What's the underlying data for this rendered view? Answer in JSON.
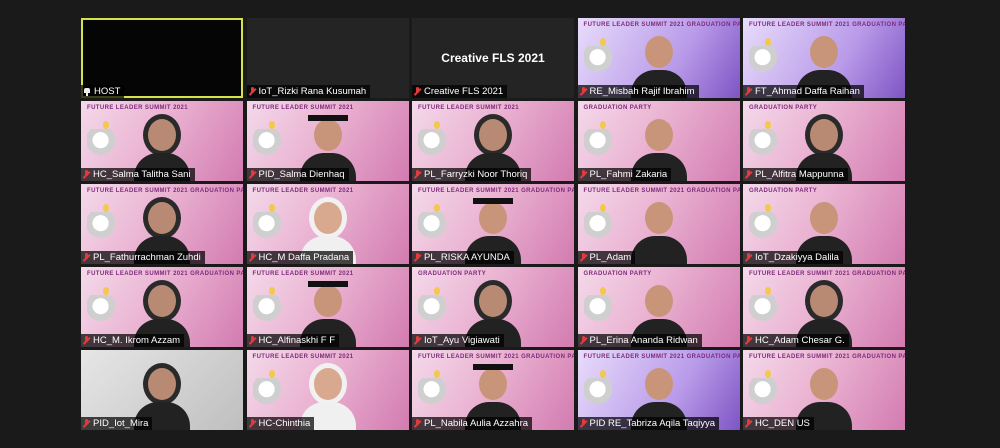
{
  "meeting": {
    "title_tile_text": "Creative FLS 2021",
    "tiles": [
      {
        "name": "HOST",
        "muted": false,
        "pinned": true,
        "bg": "host"
      },
      {
        "name": "IoT_Rizki Rana Kusumah",
        "muted": true,
        "bg": "dark"
      },
      {
        "name": "Creative FLS 2021",
        "muted": true,
        "bg": "dark",
        "center_title": "Creative FLS 2021"
      },
      {
        "name": "RE_Misbah Rajif Ibrahim",
        "muted": true,
        "bg": "purple",
        "banner": "FUTURE LEADER SUMMIT 2021 GRADUATION PARTY"
      },
      {
        "name": "FT_Ahmad Daffa Raihan",
        "muted": true,
        "bg": "purple",
        "banner": "FUTURE LEADER SUMMIT 2021 GRADUATION PARTY"
      },
      {
        "name": "HC_Salma Talitha Sani",
        "muted": true,
        "bg": "pink",
        "banner": "FUTURE LEADER SUMMIT 2021"
      },
      {
        "name": "PID_Salma Dienhaq",
        "muted": true,
        "bg": "pink",
        "banner": "FUTURE LEADER SUMMIT 2021"
      },
      {
        "name": "PL_Farryzki Noor Thoriq",
        "muted": true,
        "bg": "pink",
        "banner": "FUTURE LEADER SUMMIT 2021"
      },
      {
        "name": "PL_Fahmi Zakaria",
        "muted": true,
        "bg": "pink",
        "banner": "GRADUATION PARTY"
      },
      {
        "name": "PL_Alfitra Mappunna",
        "muted": true,
        "bg": "pink",
        "banner": "GRADUATION PARTY"
      },
      {
        "name": "PL_Fathurrachman Zuhdi",
        "muted": true,
        "bg": "pink",
        "banner": "FUTURE LEADER SUMMIT 2021 GRADUATION PARTY"
      },
      {
        "name": "HC_M Daffa Pradana",
        "muted": true,
        "bg": "pink",
        "banner": "FUTURE LEADER SUMMIT 2021"
      },
      {
        "name": "PL_RISKA AYUNDA",
        "muted": true,
        "bg": "pink",
        "banner": "FUTURE LEADER SUMMIT 2021 GRADUATION PARTY"
      },
      {
        "name": "PL_Adam",
        "muted": true,
        "bg": "pink",
        "banner": "FUTURE LEADER SUMMIT 2021 GRADUATION PARTY"
      },
      {
        "name": "IoT_Dzakiyya Dalila",
        "muted": true,
        "bg": "pink",
        "banner": "GRADUATION PARTY"
      },
      {
        "name": "HC_M. Ikrom Azzam",
        "muted": true,
        "bg": "pink",
        "banner": "FUTURE LEADER SUMMIT 2021 GRADUATION PARTY"
      },
      {
        "name": "HC_Alfinaskhi F F",
        "muted": true,
        "bg": "pink",
        "banner": "FUTURE LEADER SUMMIT 2021"
      },
      {
        "name": "IoT_Ayu Vigiawati",
        "muted": true,
        "bg": "pink",
        "banner": "GRADUATION PARTY"
      },
      {
        "name": "PL_Erina Ananda Ridwan",
        "muted": true,
        "bg": "pink",
        "banner": "GRADUATION PARTY"
      },
      {
        "name": "HC_Adam Chesar G.",
        "muted": true,
        "bg": "pink",
        "banner": "FUTURE LEADER SUMMIT 2021 GRADUATION PARTY"
      },
      {
        "name": "PID_Iot_Mira",
        "muted": true,
        "bg": "photo"
      },
      {
        "name": "HC-Chinthia",
        "muted": true,
        "bg": "pink",
        "banner": "FUTURE LEADER SUMMIT 2021"
      },
      {
        "name": "PL_Nabila Aulia Azzahra",
        "muted": true,
        "bg": "pink",
        "banner": "FUTURE LEADER SUMMIT 2021 GRADUATION PARTY"
      },
      {
        "name": "PID RE_Tabriza Aqila Taqiyya",
        "muted": true,
        "bg": "purple",
        "banner": "FUTURE LEADER SUMMIT 2021 GRADUATION PARTY"
      },
      {
        "name": "HC_DEN US",
        "muted": true,
        "bg": "pink",
        "banner": "FUTURE LEADER SUMMIT 2021 GRADUATION PARTY"
      }
    ]
  }
}
